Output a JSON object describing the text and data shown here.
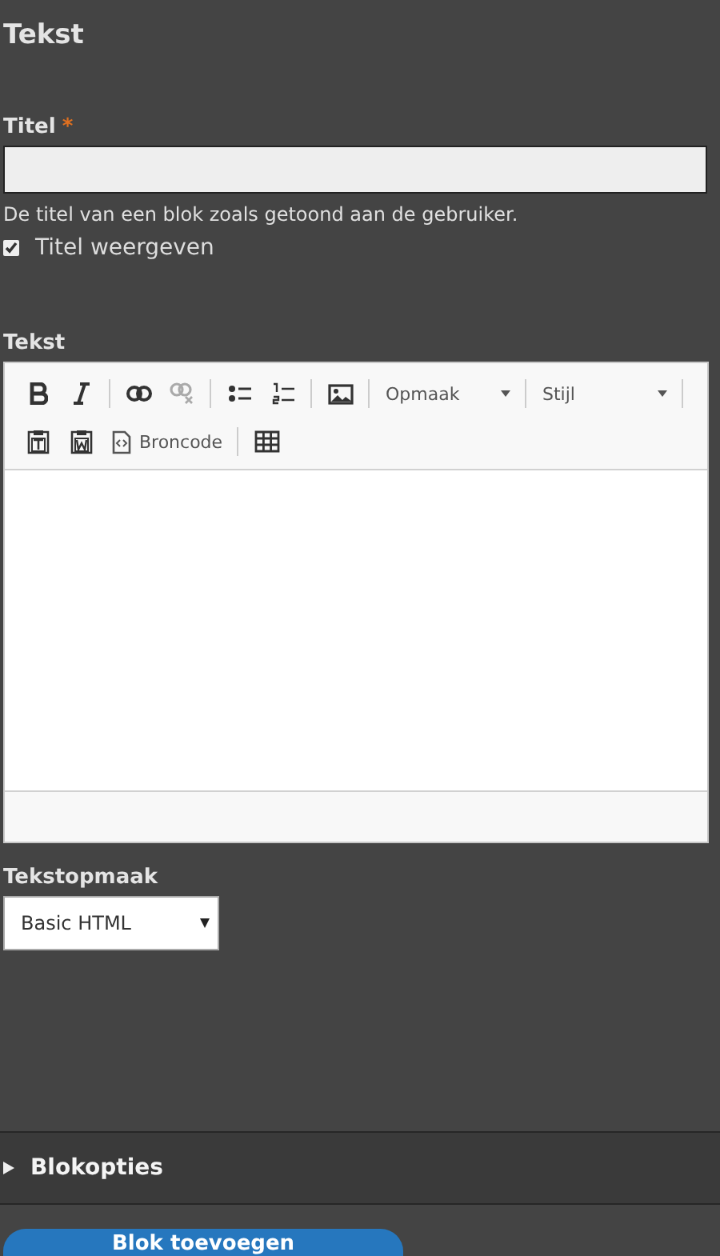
{
  "heading": "Tekst",
  "title_field": {
    "label": "Titel",
    "required_mark": "*",
    "description": "De titel van een blok zoals getoond aan de gebruiker."
  },
  "display_title": {
    "label": "Titel weergeven",
    "checked": true
  },
  "body_field": {
    "label": "Tekst",
    "toolbar": [
      {
        "kind": "bold",
        "disabled": false
      },
      {
        "kind": "italic",
        "disabled": false
      },
      {
        "kind": "separator"
      },
      {
        "kind": "link",
        "disabled": false
      },
      {
        "kind": "unlink",
        "disabled": true
      },
      {
        "kind": "separator"
      },
      {
        "kind": "bullets",
        "disabled": false
      },
      {
        "kind": "numbers",
        "disabled": false
      },
      {
        "kind": "separator"
      },
      {
        "kind": "image",
        "disabled": false
      },
      {
        "kind": "separator"
      },
      {
        "kind": "dropdown",
        "label": "Opmaak"
      },
      {
        "kind": "separator"
      },
      {
        "kind": "dropdown",
        "label": "Stijl"
      },
      {
        "kind": "separator"
      },
      {
        "kind": "paste-text",
        "disabled": false
      },
      {
        "kind": "paste-word",
        "disabled": false
      },
      {
        "kind": "source",
        "label": "Broncode"
      },
      {
        "kind": "separator"
      },
      {
        "kind": "table",
        "disabled": false
      }
    ]
  },
  "format_field": {
    "label": "Tekstopmaak",
    "value": "Basic HTML"
  },
  "options_section": {
    "label": "Blokopties",
    "expanded": false
  },
  "submit_button": "Blok toevoegen"
}
